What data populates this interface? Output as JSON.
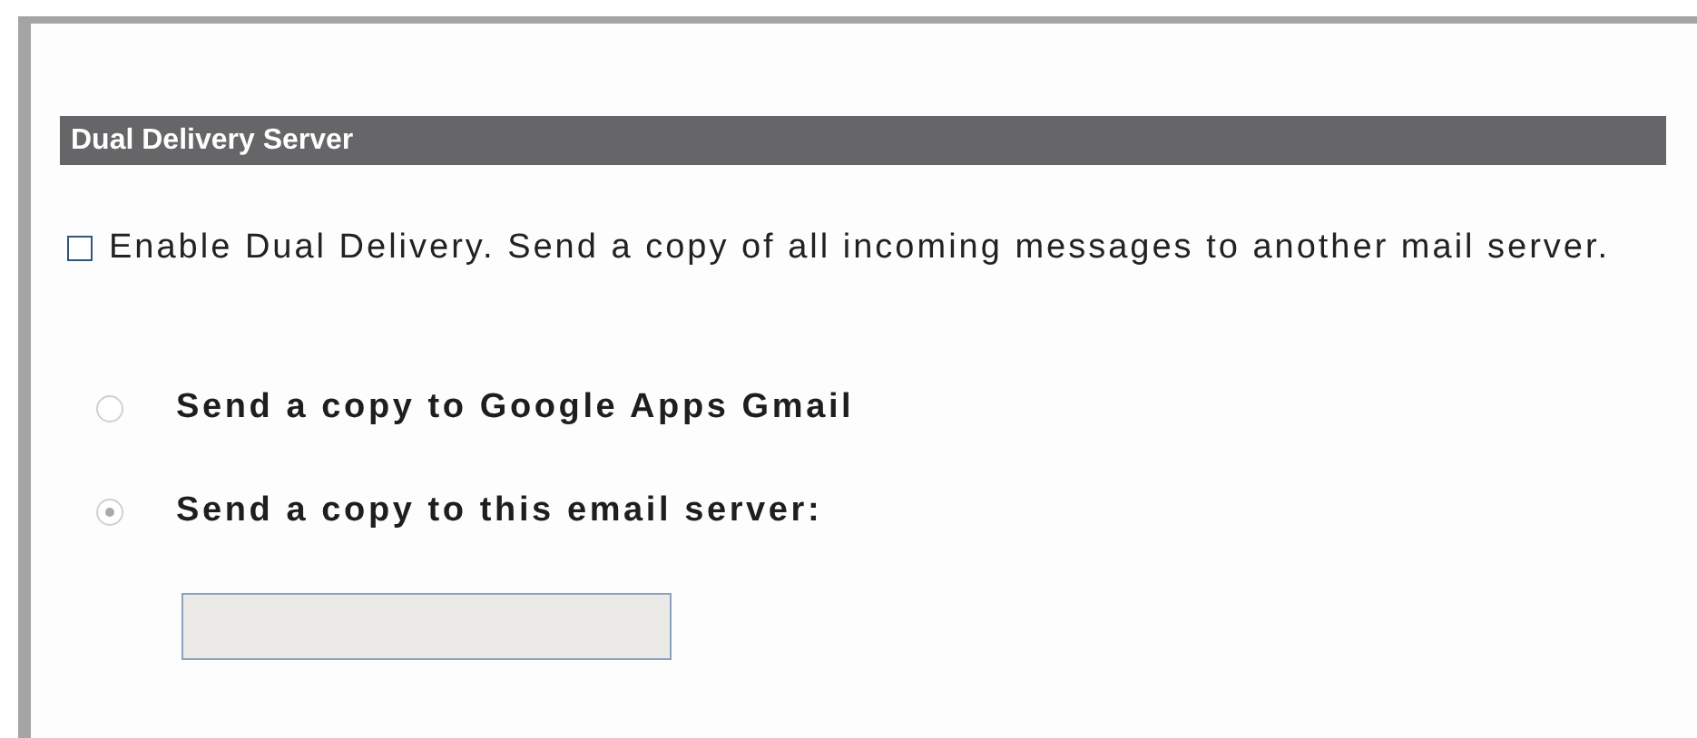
{
  "section": {
    "title": "Dual Delivery Server"
  },
  "enable": {
    "label": "Enable Dual Delivery. Send a copy of all incoming messages to another mail server.",
    "checked": false
  },
  "options": [
    {
      "label": "Send a copy to Google Apps Gmail",
      "selected": false,
      "disabled": true
    },
    {
      "label": "Send a copy to this email server:",
      "selected": true,
      "disabled": true
    }
  ],
  "server_field": {
    "disabled": true
  }
}
